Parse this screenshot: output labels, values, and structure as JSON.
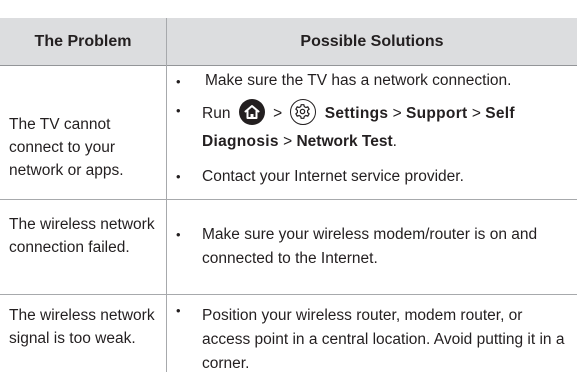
{
  "table": {
    "headers": {
      "problem": "The Problem",
      "solutions": "Possible  Solutions"
    },
    "rows": [
      {
        "problem": "The TV cannot connect to your network or apps.",
        "solutions": [
          {
            "text": "Make sure the TV has a network connection."
          },
          {
            "run": "Run",
            "sep": ">",
            "settings": "Settings",
            "support": "Support",
            "self_diagnosis": "Self Diagnosis",
            "network_test": "Network Test",
            "end": ".",
            "icons": [
              "home-icon",
              "gear-icon"
            ]
          },
          {
            "text": "Contact your Internet service provider."
          }
        ]
      },
      {
        "problem": "The wireless network connection failed.",
        "solutions": [
          {
            "text": "Make sure your wireless modem/router is on and connected to the Internet."
          }
        ]
      },
      {
        "problem": "The wireless network signal is too weak.",
        "solutions": [
          {
            "text": "Position your wireless router, modem router, or access point in a central location. Avoid putting it in a corner."
          }
        ]
      }
    ]
  },
  "colors": {
    "header_bg": "#dcdddf",
    "text": "#231f20",
    "rule": "#a7a9ac"
  }
}
